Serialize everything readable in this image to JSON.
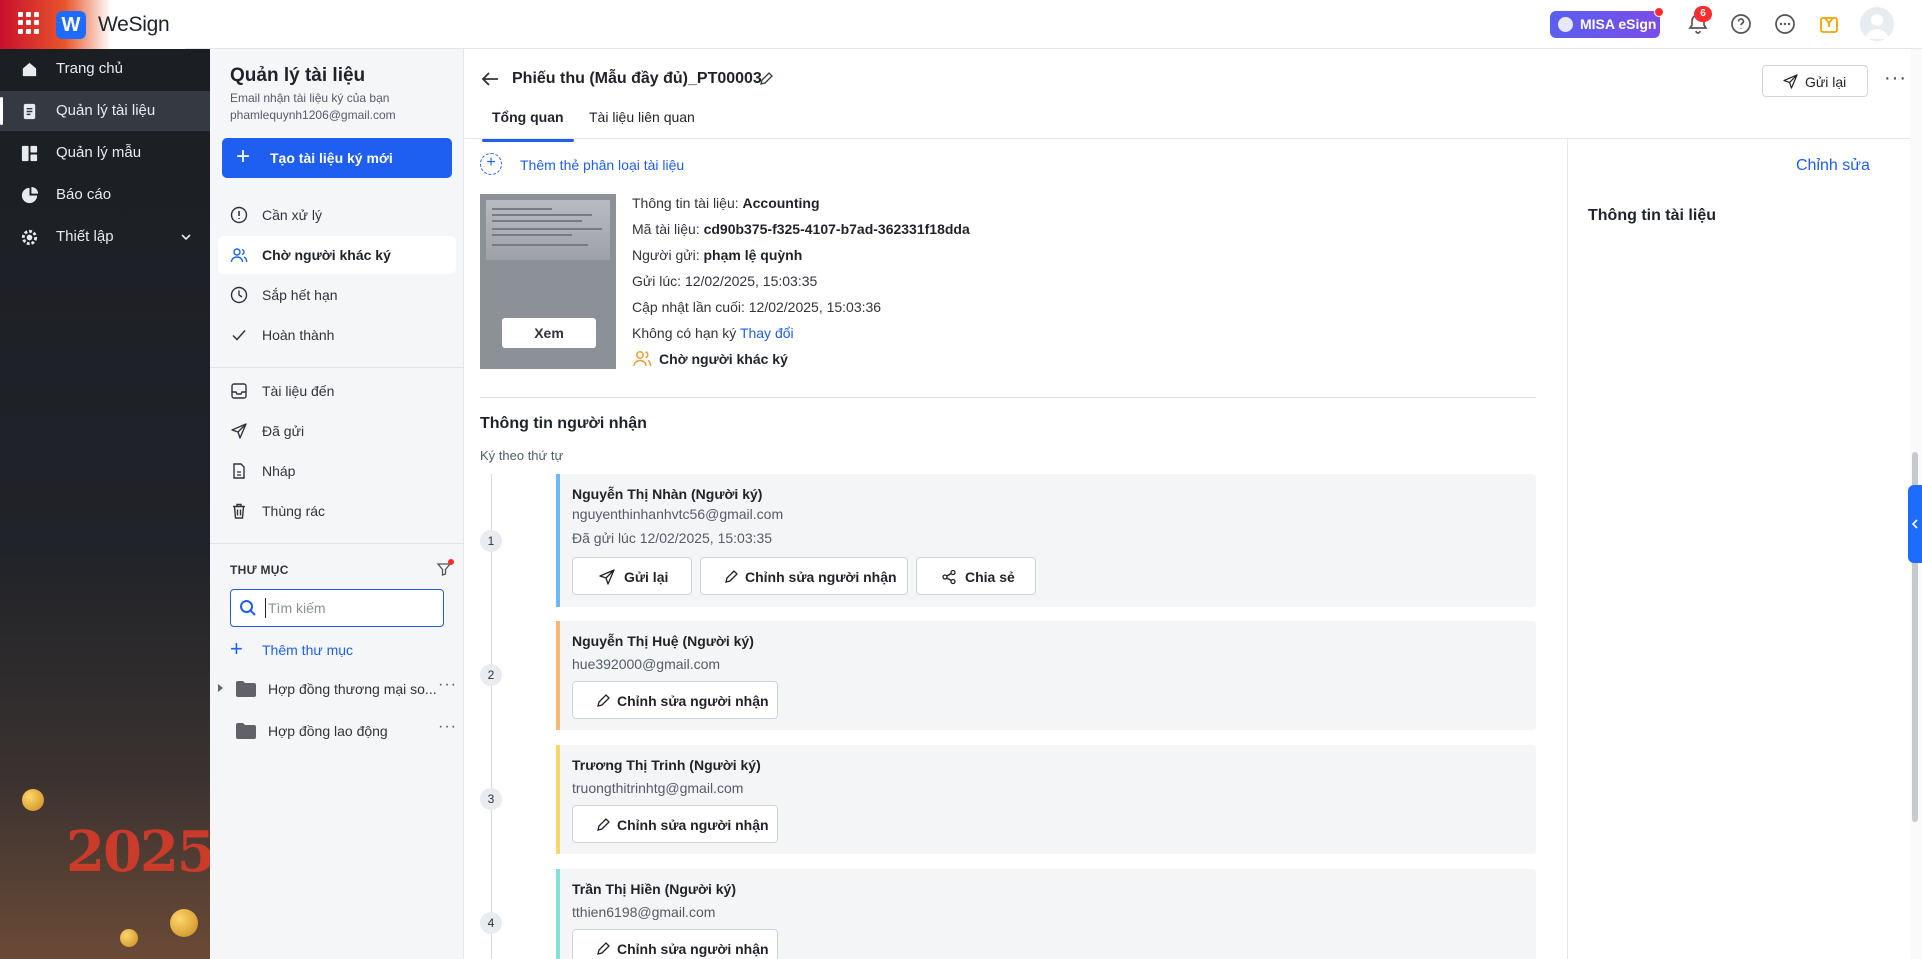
{
  "app": {
    "name": "WeSign",
    "logo_letter": "W",
    "brand_badge": "MISA eSign",
    "notification_count": "6"
  },
  "sidebar": {
    "items": [
      {
        "label": "Trang chủ",
        "icon": "home-icon"
      },
      {
        "label": "Quản lý tài liệu",
        "icon": "document-icon",
        "active": true
      },
      {
        "label": "Quản lý mẫu",
        "icon": "template-icon"
      },
      {
        "label": "Báo cáo",
        "icon": "chart-pie-icon"
      },
      {
        "label": "Thiết lập",
        "icon": "gear-icon"
      }
    ],
    "decoration_text": "2025"
  },
  "subnav": {
    "title": "Quản lý tài liệu",
    "email_note": "Email nhận tài liệu ký của bạn",
    "email": "phamlequynh1206@gmail.com",
    "create_button": "Tạo tài liệu ký mới",
    "status_items": [
      {
        "label": "Cần xử lý",
        "icon": "alert-circle-icon"
      },
      {
        "label": "Chờ người khác ký",
        "icon": "users-icon",
        "active": true
      },
      {
        "label": "Sắp hết hạn",
        "icon": "clock-icon"
      },
      {
        "label": "Hoàn thành",
        "icon": "check-icon"
      }
    ],
    "box_items": [
      {
        "label": "Tài liệu đến",
        "icon": "inbox-icon"
      },
      {
        "label": "Đã gửi",
        "icon": "send-icon"
      },
      {
        "label": "Nháp",
        "icon": "file-icon"
      },
      {
        "label": "Thùng rác",
        "icon": "trash-icon"
      }
    ],
    "folder_heading": "THƯ MỤC",
    "search_placeholder": "Tìm kiếm",
    "add_folder": "Thêm thư mục",
    "folders": [
      {
        "label": "Hợp đồng thương mại so...",
        "expandable": true
      },
      {
        "label": "Hợp đồng lao động",
        "expandable": false
      }
    ]
  },
  "document": {
    "title": "Phiếu thu (Mẫu đầy đủ)_PT00003",
    "resend_button": "Gửi lại",
    "tabs": [
      {
        "label": "Tổng quan",
        "active": true
      },
      {
        "label": "Tài liệu liên quan"
      }
    ],
    "add_tag": "Thêm thẻ phân loại tài liệu",
    "view_button": "Xem",
    "info": {
      "category_label": "Thông tin tài liệu:",
      "category_value": "Accounting",
      "code_label": "Mã tài liệu:",
      "code_value": "cd90b375-f325-4107-b7ad-362331f18dda",
      "sender_label": "Người gửi:",
      "sender_value": "phạm lệ quỳnh",
      "sent_at": "Gửi lúc: 12/02/2025, 15:03:35",
      "updated_at": "Cập nhật lần cuối: 12/02/2025, 15:03:36",
      "deadline_text": "Không có hạn ký",
      "deadline_link": "Thay đổi",
      "status": "Chờ người khác ký"
    },
    "recipients_title": "Thông tin người nhận",
    "order_note": "Ký theo thứ tự",
    "recipients": [
      {
        "step": "1",
        "name": "Nguyễn Thị Nhàn (Người ký)",
        "email": "nguyenthinhanhvtc56@gmail.com",
        "sent": "Đã gửi lúc 12/02/2025, 15:03:35",
        "color": "#6fb8f5"
      },
      {
        "step": "2",
        "name": "Nguyễn Thị Huệ (Người ký)",
        "email": "hue392000@gmail.com",
        "color": "#f5b77a"
      },
      {
        "step": "3",
        "name": "Trương Thị Trinh (Người ký)",
        "email": "truongthitrinhtg@gmail.com",
        "color": "#f7d76a"
      },
      {
        "step": "4",
        "name": "Trần Thị Hiền (Người ký)",
        "email": "tthien6198@gmail.com",
        "color": "#86e0d8"
      }
    ],
    "btn_resend": "Gửi lại",
    "btn_edit_recipient": "Chỉnh sửa người nhận",
    "btn_share": "Chia sẻ"
  },
  "right_panel": {
    "title": "Thông tin tài liệu",
    "edit": "Chỉnh sửa"
  },
  "colors": {
    "primary": "#1e5ef0",
    "sidebar_bg": "#1b1e23",
    "waiting": "#f29b38"
  }
}
